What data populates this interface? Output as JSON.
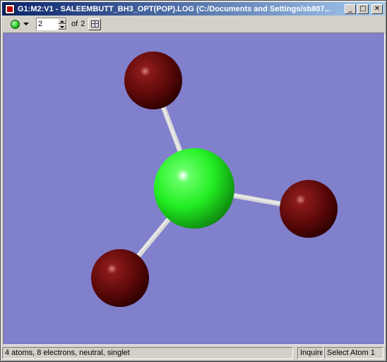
{
  "window": {
    "title": "G1:M2:V1 - SALEEMBUTT_BH3_OPT(POP).LOG (C:/Documents and Settings/sb807...",
    "minimize_glyph": "_",
    "maximize_glyph": "□",
    "close_glyph": "✕"
  },
  "toolbar": {
    "model_index": "2",
    "of_label": "of",
    "model_total": "2"
  },
  "molecule": {
    "background_color": "#8080cc",
    "central_atom_color": "#22ee22",
    "terminal_atom_color": "#6a0a0a",
    "bond_color": "#d8d8d8",
    "atoms": [
      {
        "element": "central"
      },
      {
        "element": "terminal"
      },
      {
        "element": "terminal"
      },
      {
        "element": "terminal"
      }
    ]
  },
  "status": {
    "summary": "4 atoms, 8 electrons, neutral, singlet",
    "mode": "Inquire",
    "action": "Select Atom 1"
  }
}
